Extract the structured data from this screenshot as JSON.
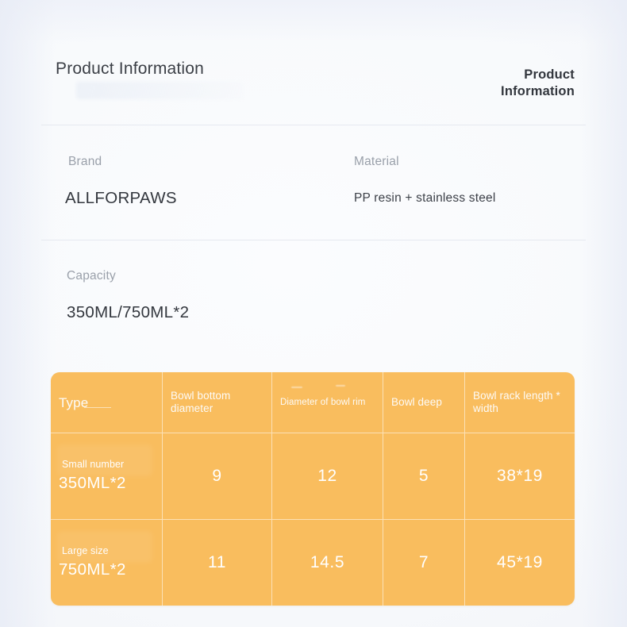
{
  "header": {
    "title": "Product Information",
    "badge_line1": "Product",
    "badge_line2": "Information"
  },
  "specs": [
    {
      "label": "Brand",
      "value": "ALLFORPAWS"
    },
    {
      "label": "Material",
      "value": "PP resin + stainless steel"
    },
    {
      "label": "Capacity",
      "value": "350ML/750ML*2"
    }
  ],
  "table": {
    "headers": [
      "Type",
      "Bowl bottom diameter",
      "Diameter of bowl rim",
      "Bowl deep",
      "Bowl rack length * width"
    ],
    "rows": [
      {
        "type_sub": "Small number",
        "type_main": "350ML*2",
        "bowl_bottom_diameter": "9",
        "bowl_rim_diameter": "12",
        "bowl_deep": "5",
        "bowl_rack": "38*19"
      },
      {
        "type_sub": "Large size",
        "type_main": "750ML*2",
        "bowl_bottom_diameter": "11",
        "bowl_rim_diameter": "14.5",
        "bowl_deep": "7",
        "bowl_rack": "45*19"
      }
    ]
  },
  "colors": {
    "table_orange": "#F9BD5E",
    "page_background": "#F7F9FC",
    "divider": "#E6E9F0",
    "label_gray": "#9AA0AA",
    "value_dark": "#33373E"
  }
}
